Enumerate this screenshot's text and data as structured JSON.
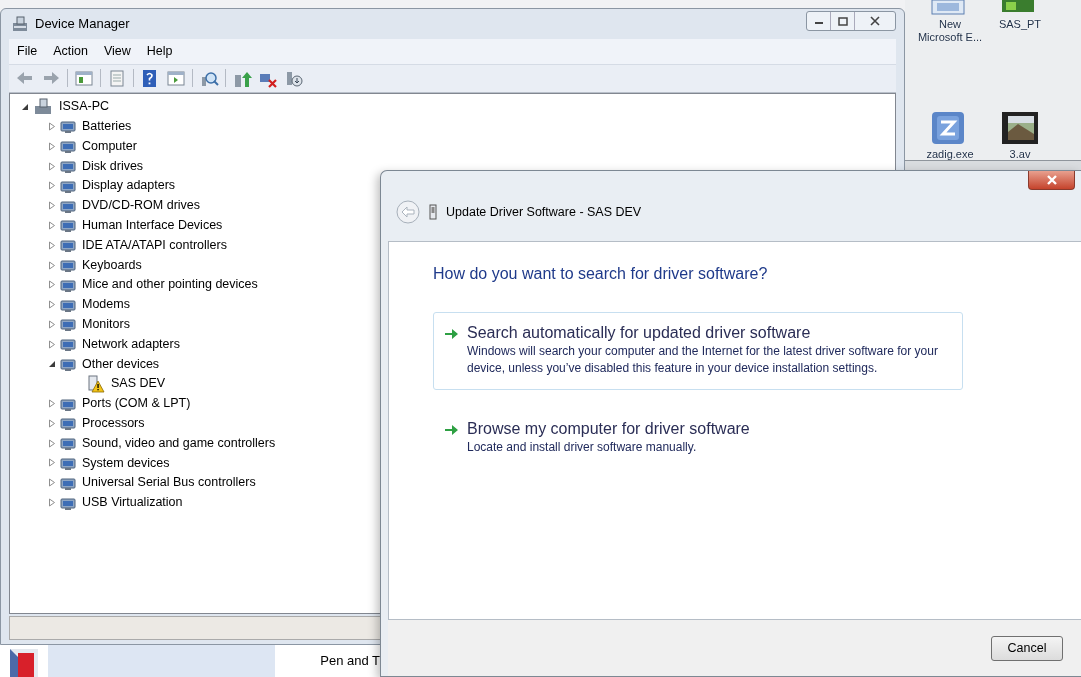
{
  "device_manager": {
    "title": "Device Manager",
    "menu": [
      "File",
      "Action",
      "View",
      "Help"
    ],
    "tree": [
      {
        "label": "ISSA-PC",
        "expanded": true,
        "children": [
          {
            "label": "Batteries",
            "expanded": false
          },
          {
            "label": "Computer",
            "expanded": false
          },
          {
            "label": "Disk drives",
            "expanded": false
          },
          {
            "label": "Display adapters",
            "expanded": false
          },
          {
            "label": "DVD/CD-ROM drives",
            "expanded": false
          },
          {
            "label": "Human Interface Devices",
            "expanded": false
          },
          {
            "label": "IDE ATA/ATAPI controllers",
            "expanded": false
          },
          {
            "label": "Keyboards",
            "expanded": false
          },
          {
            "label": "Mice and other pointing devices",
            "expanded": false
          },
          {
            "label": "Modems",
            "expanded": false
          },
          {
            "label": "Monitors",
            "expanded": false
          },
          {
            "label": "Network adapters",
            "expanded": false
          },
          {
            "label": "Other devices",
            "expanded": true,
            "children": [
              {
                "label": "SAS DEV",
                "warning": true
              }
            ]
          },
          {
            "label": "Ports (COM & LPT)",
            "expanded": false
          },
          {
            "label": "Processors",
            "expanded": false
          },
          {
            "label": "Sound, video and game controllers",
            "expanded": false
          },
          {
            "label": "System devices",
            "expanded": false
          },
          {
            "label": "Universal Serial Bus controllers",
            "expanded": false
          },
          {
            "label": "USB Virtualization",
            "expanded": false
          }
        ]
      }
    ]
  },
  "desktop": {
    "icons": [
      {
        "label": "New Microsoft E..."
      },
      {
        "label": "SAS_PT"
      },
      {
        "label": "zadig.exe"
      },
      {
        "label": "3.av"
      }
    ]
  },
  "taskbar": {
    "label": "Pen and T"
  },
  "dialog": {
    "title": "Update Driver Software - SAS DEV",
    "heading": "How do you want to search for driver software?",
    "options": [
      {
        "title": "Search automatically for updated driver software",
        "description": "Windows will search your computer and the Internet for the latest driver software for your device, unless you’ve disabled this feature in your device installation settings.",
        "hovered": true
      },
      {
        "title": "Browse my computer for driver software",
        "description": "Locate and install driver software manually.",
        "hovered": false
      }
    ],
    "buttons": [
      "Cancel"
    ]
  }
}
